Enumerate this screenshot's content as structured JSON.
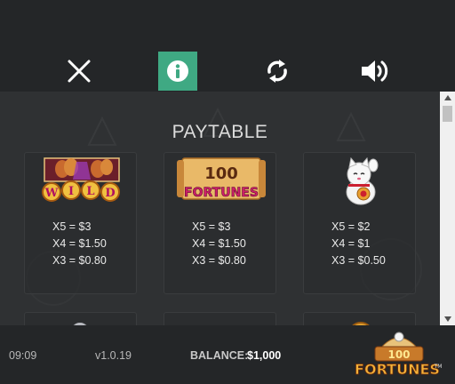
{
  "toolbar": {
    "close_icon": "close-icon",
    "info_icon": "info-icon",
    "refresh_icon": "refresh-icon",
    "sound_icon": "speaker-icon",
    "info_color": "#3fa983"
  },
  "paytable": {
    "title": "PAYTABLE",
    "symbols": [
      {
        "name": "WILD",
        "pays": [
          "X5 = $3",
          "X4 = $1.50",
          "X3 = $0.80"
        ]
      },
      {
        "name_top": "100",
        "name": "FORTUNES",
        "pays": [
          "X5 = $3",
          "X4 = $1.50",
          "X3 = $0.80"
        ]
      },
      {
        "name": "lucky-cat",
        "pays": [
          "X5 = $2",
          "X4 = $1",
          "X3 = $0.50"
        ]
      }
    ]
  },
  "footer": {
    "time": "09:09",
    "version": "v1.0.19",
    "balance_label": "BALANCE:",
    "balance_value": "$1,000",
    "logo_top": "100",
    "logo_text": "FORTUNES",
    "logo_tm": "TM"
  }
}
